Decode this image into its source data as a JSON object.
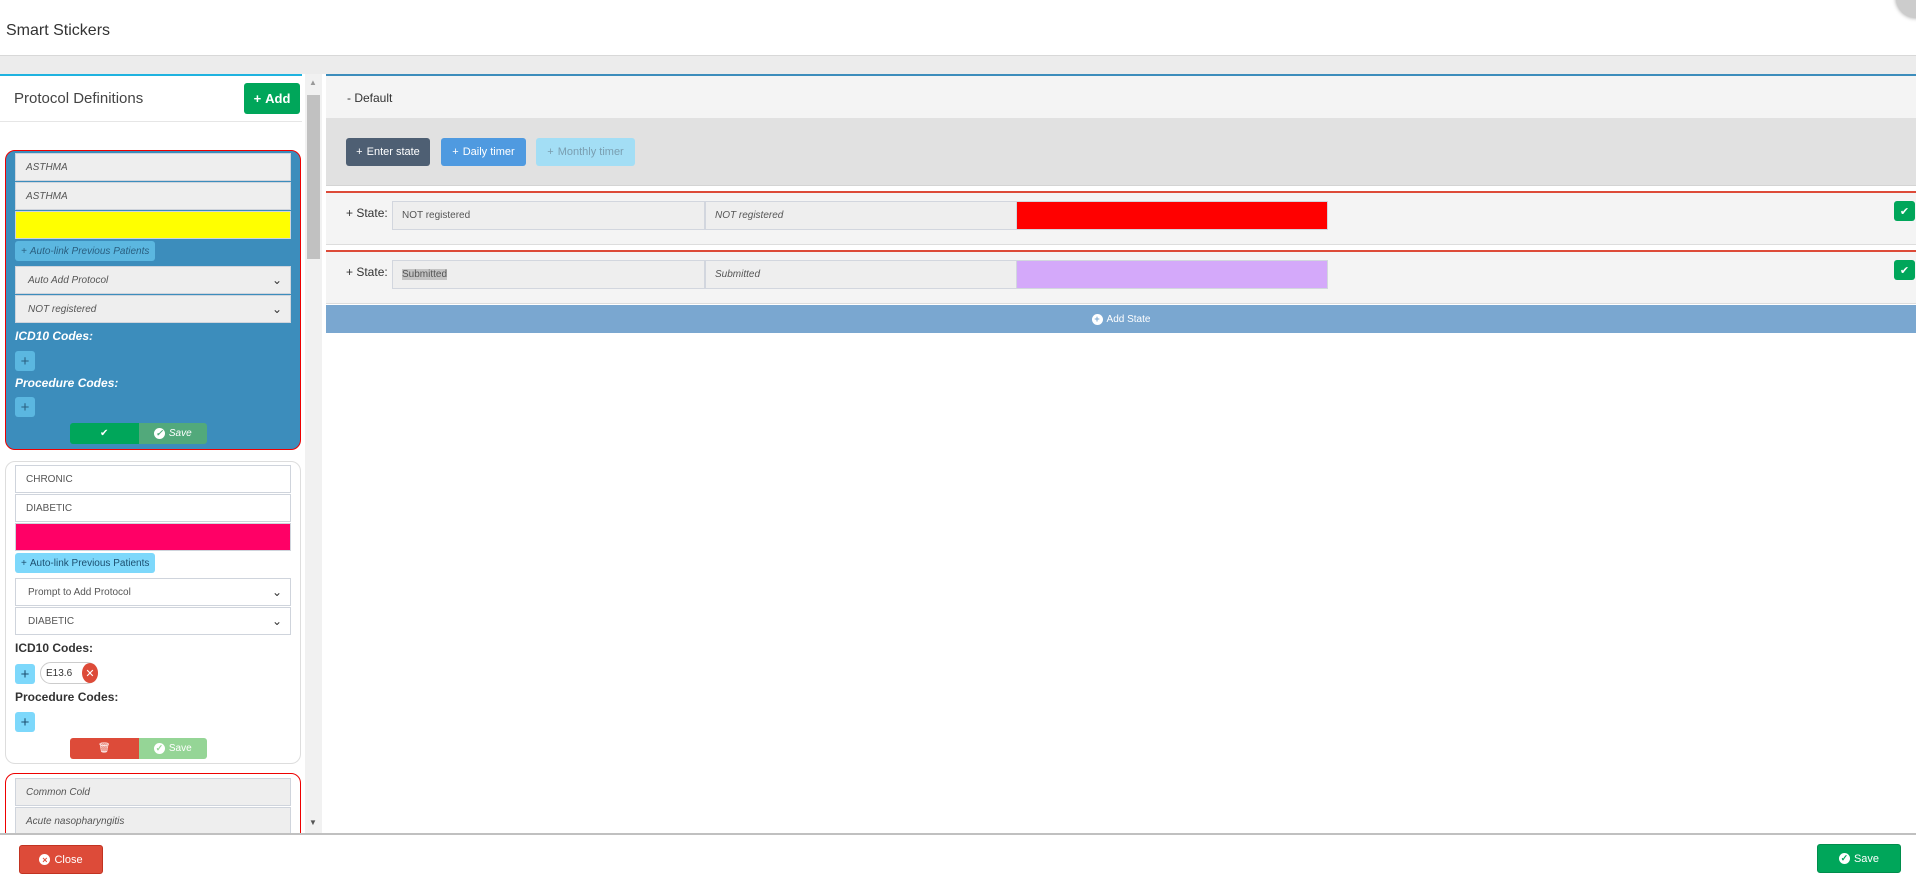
{
  "header": {
    "title": "Smart Stickers"
  },
  "left": {
    "title": "Protocol Definitions",
    "add_label": "Add",
    "protocols": [
      {
        "name": "ASTHMA",
        "display": "ASTHMA",
        "color": "#ffff00",
        "autolink": "Auto-link Previous Patients",
        "action": "Auto Add Protocol",
        "state": "NOT registered",
        "icd_label": "ICD10 Codes:",
        "proc_label": "Procedure Codes:",
        "save": "Save"
      },
      {
        "name": "CHRONIC",
        "display": "DIABETIC",
        "color": "#ff0066",
        "autolink": "Auto-link Previous Patients",
        "action": "Prompt to Add Protocol",
        "state": "DIABETIC",
        "icd_label": "ICD10 Codes:",
        "icd_codes": [
          "E13.6"
        ],
        "proc_label": "Procedure Codes:",
        "save": "Save"
      },
      {
        "name": "Common Cold",
        "display": "Acute nasopharyngitis"
      }
    ]
  },
  "right": {
    "section": "- Default",
    "buttons": {
      "enter_state": "Enter state",
      "daily_timer": "Daily timer",
      "monthly_timer": "Monthly timer"
    },
    "state_label": "+ State:",
    "states": [
      {
        "name": "NOT registered",
        "display": "NOT registered",
        "color": "#ff0000"
      },
      {
        "name": "Submitted",
        "display": "Submitted",
        "color": "#d4a9fa"
      }
    ],
    "add_state": "Add State"
  },
  "footer": {
    "close": "Close",
    "save": "Save"
  }
}
